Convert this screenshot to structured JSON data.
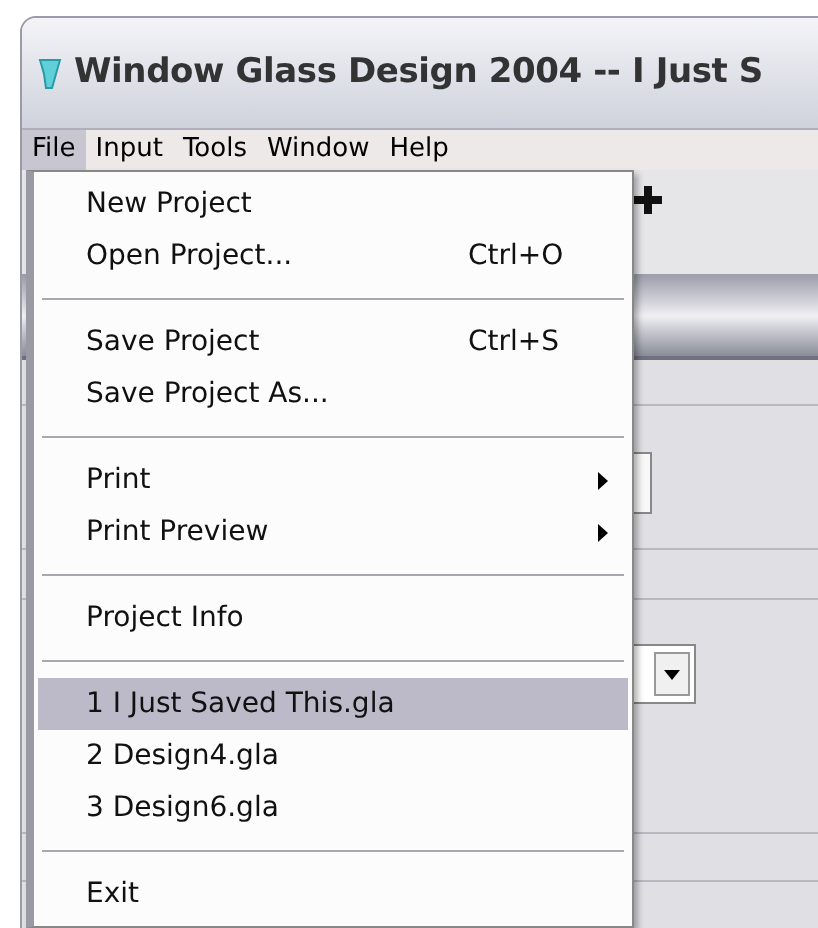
{
  "window": {
    "title": "Window Glass Design 2004 -- I Just S"
  },
  "menu_bar": [
    {
      "label": "File",
      "selected": true
    },
    {
      "label": "Input",
      "selected": false
    },
    {
      "label": "Tools",
      "selected": false
    },
    {
      "label": "Window",
      "selected": false
    },
    {
      "label": "Help",
      "selected": false
    }
  ],
  "file_menu": {
    "groups": [
      [
        {
          "label": "New Project",
          "submenu": false,
          "selected": false
        },
        {
          "label": "Open Project...",
          "shortcut": "Ctrl+O",
          "submenu": false,
          "selected": false
        }
      ],
      [
        {
          "label": "Save Project",
          "shortcut": "Ctrl+S",
          "submenu": false,
          "selected": false
        },
        {
          "label": "Save Project As...",
          "submenu": false,
          "selected": false
        }
      ],
      [
        {
          "label": "Print",
          "submenu": true,
          "selected": false
        },
        {
          "label": "Print Preview",
          "submenu": true,
          "selected": false
        }
      ],
      [
        {
          "label": "Project Info",
          "submenu": false,
          "selected": false
        }
      ],
      [
        {
          "label": "1 I Just Saved This.gla",
          "submenu": false,
          "selected": true
        },
        {
          "label": "2 Design4.gla",
          "submenu": false,
          "selected": false
        },
        {
          "label": "3 Design6.gla",
          "submenu": false,
          "selected": false
        }
      ],
      [
        {
          "label": "Exit",
          "submenu": false,
          "selected": false
        }
      ]
    ]
  }
}
